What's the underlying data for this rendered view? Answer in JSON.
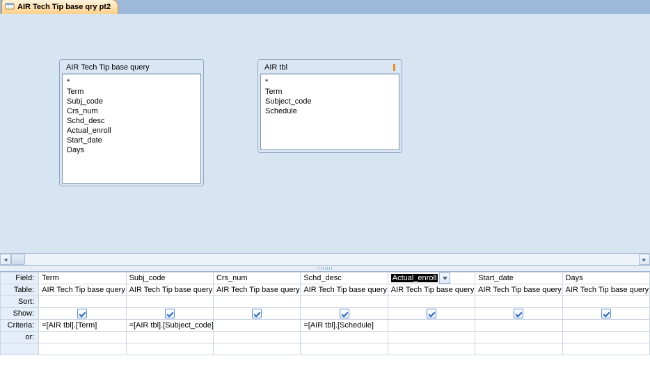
{
  "tab_title": "AIR Tech Tip base qry pt2",
  "relation_boxes": [
    {
      "title": "AIR Tech Tip base query",
      "fields": [
        "*",
        "Term",
        "Subj_code",
        "Crs_num",
        "Schd_desc",
        "Actual_enroll",
        "Start_date",
        "Days"
      ]
    },
    {
      "title": "AIR tbl",
      "fields": [
        "*",
        "Term",
        "Subject_code",
        "Schedule"
      ]
    }
  ],
  "grid": {
    "headers": {
      "field": "Field:",
      "table": "Table:",
      "sort": "Sort:",
      "show": "Show:",
      "criteria": "Criteria:",
      "or": "or:"
    },
    "columns": [
      {
        "field": "Term",
        "table": "AIR Tech Tip base query",
        "show": true,
        "criteria": "=[AIR tbl].[Term]",
        "selected": false
      },
      {
        "field": "Subj_code",
        "table": "AIR Tech Tip base query",
        "show": true,
        "criteria": "=[AIR tbl].[Subject_code]",
        "selected": false
      },
      {
        "field": "Crs_num",
        "table": "AIR Tech Tip base query",
        "show": true,
        "criteria": "",
        "selected": false
      },
      {
        "field": "Schd_desc",
        "table": "AIR Tech Tip base query",
        "show": true,
        "criteria": "=[AIR tbl].[Schedule]",
        "selected": false
      },
      {
        "field": "Actual_enroll",
        "table": "AIR Tech Tip base query",
        "show": true,
        "criteria": "",
        "selected": true
      },
      {
        "field": "Start_date",
        "table": "AIR Tech Tip base query",
        "show": true,
        "criteria": "",
        "selected": false
      },
      {
        "field": "Days",
        "table": "AIR Tech Tip base query",
        "show": true,
        "criteria": "",
        "selected": false
      }
    ]
  }
}
